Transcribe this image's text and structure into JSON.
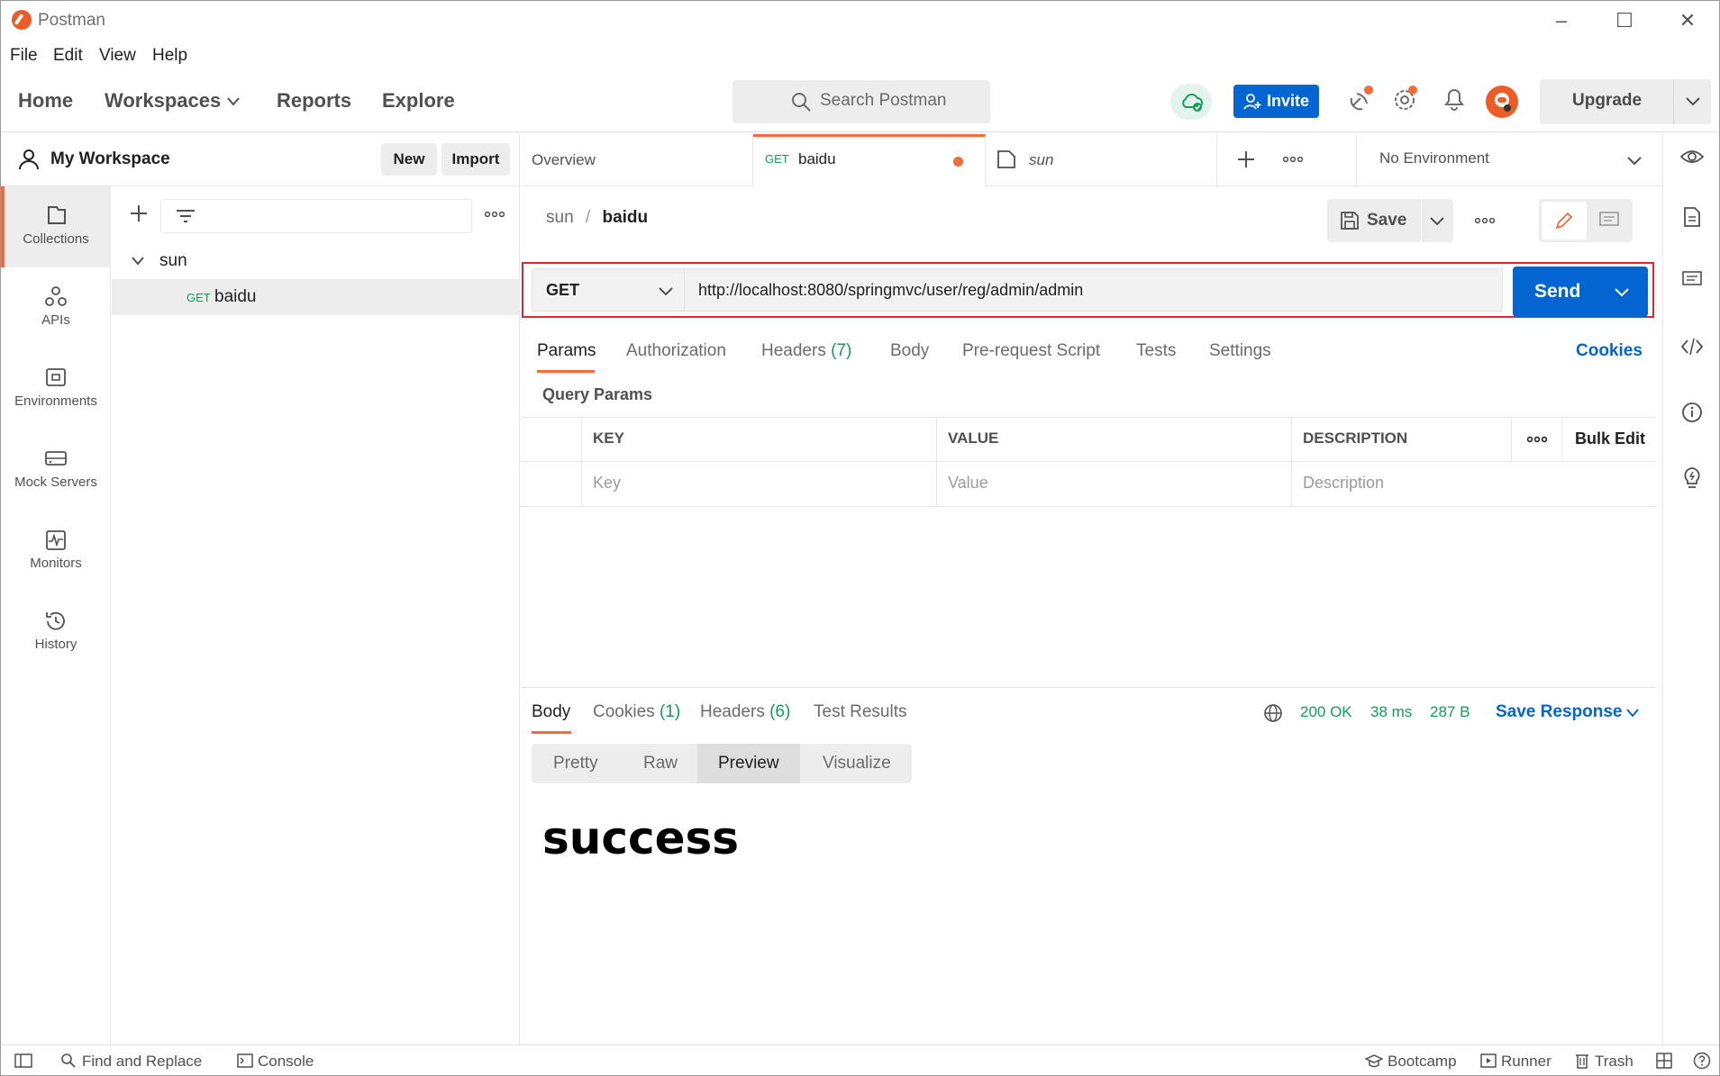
{
  "window": {
    "title": "Postman"
  },
  "menu": [
    "File",
    "Edit",
    "View",
    "Help"
  ],
  "header": {
    "nav": [
      "Home",
      "Workspaces",
      "Reports",
      "Explore"
    ],
    "search_placeholder": "Search Postman",
    "invite_label": "Invite",
    "upgrade_label": "Upgrade"
  },
  "workspace": {
    "title": "My Workspace",
    "new_label": "New",
    "import_label": "Import"
  },
  "leftnav": [
    "Collections",
    "APIs",
    "Environments",
    "Mock Servers",
    "Monitors",
    "History"
  ],
  "tree": {
    "collection": "sun",
    "request_method": "GET",
    "request_name": "baidu"
  },
  "tabs": {
    "overview": "Overview",
    "active_method": "GET",
    "active_name": "baidu",
    "third": "sun",
    "environment": "No Environment"
  },
  "request": {
    "breadcrumb_parent": "sun",
    "breadcrumb_sep": "/",
    "breadcrumb_current": "baidu",
    "save_label": "Save",
    "method": "GET",
    "url": "http://localhost:8080/springmvc/user/reg/admin/admin",
    "send_label": "Send",
    "tabs": [
      "Params",
      "Authorization",
      "Headers",
      "Body",
      "Pre-request Script",
      "Tests",
      "Settings"
    ],
    "headers_count": "(7)",
    "cookies_label": "Cookies",
    "query_params_title": "Query Params",
    "columns": [
      "KEY",
      "VALUE",
      "DESCRIPTION"
    ],
    "bulk_edit": "Bulk Edit",
    "placeholders": [
      "Key",
      "Value",
      "Description"
    ]
  },
  "response": {
    "tabs": [
      "Body",
      "Cookies",
      "Headers",
      "Test Results"
    ],
    "cookies_count": "(1)",
    "headers_count": "(6)",
    "status": "200 OK",
    "time": "38 ms",
    "size": "287 B",
    "save_response": "Save Response",
    "views": [
      "Pretty",
      "Raw",
      "Preview",
      "Visualize"
    ],
    "body_text": "success"
  },
  "statusbar": {
    "find_replace": "Find and Replace",
    "console": "Console",
    "bootcamp": "Bootcamp",
    "runner": "Runner",
    "trash": "Trash"
  },
  "colors": {
    "accent": "#f26b3a",
    "primary": "#0265d2",
    "success": "#0f9d58",
    "highlight_border": "#e0262f"
  }
}
